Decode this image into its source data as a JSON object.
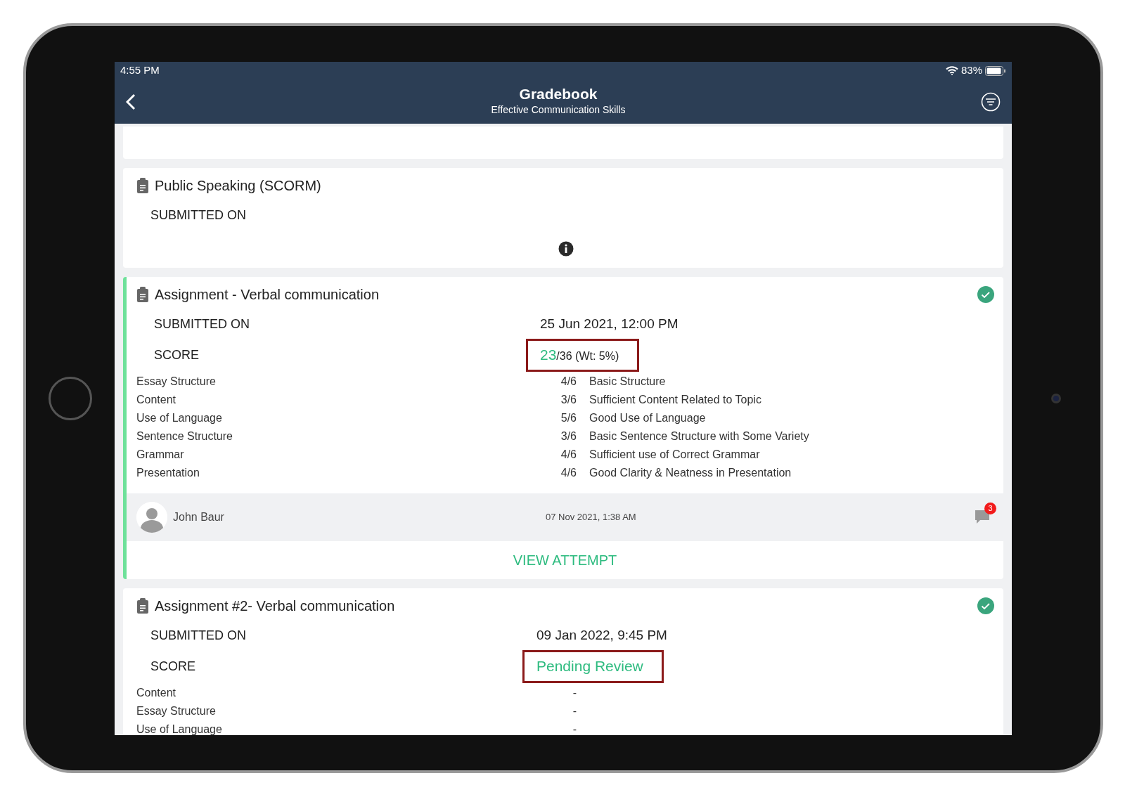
{
  "status_bar": {
    "time": "4:55 PM",
    "battery": "83%"
  },
  "header": {
    "title": "Gradebook",
    "subtitle": "Effective Communication Skills"
  },
  "cards": [
    {
      "kind": "empty"
    },
    {
      "kind": "activity",
      "title": "Public Speaking (SCORM)",
      "completed": false,
      "accent": false,
      "submitted_label": "SUBMITTED ON",
      "info_icon": true
    },
    {
      "kind": "activity",
      "title": "Assignment - Verbal communication",
      "completed": true,
      "accent": true,
      "submitted_label": "SUBMITTED ON",
      "submitted_on": "25 Jun 2021, 12:00 PM",
      "score_label": "SCORE",
      "score": {
        "value": "23",
        "total": "/36 (Wt: 5%)",
        "highlighted": true
      },
      "criteria": [
        {
          "name": "Essay Structure",
          "points": "4/6",
          "comment": "Basic Structure"
        },
        {
          "name": "Content",
          "points": "3/6",
          "comment": "Sufficient Content Related to Topic"
        },
        {
          "name": "Use of Language",
          "points": "5/6",
          "comment": "Good Use of Language"
        },
        {
          "name": "Sentence Structure",
          "points": "3/6",
          "comment": "Basic Sentence Structure with Some Variety"
        },
        {
          "name": "Grammar",
          "points": "4/6",
          "comment": "Sufficient use of Correct Grammar"
        },
        {
          "name": "Presentation",
          "points": "4/6",
          "comment": "Good Clarity & Neatness in Presentation"
        }
      ],
      "grader": {
        "name": "John Baur",
        "date": "07 Nov 2021, 1:38 AM",
        "comment_count": "3"
      },
      "action": "VIEW ATTEMPT"
    },
    {
      "kind": "activity",
      "title": "Assignment #2- Verbal communication",
      "completed": true,
      "accent": false,
      "submitted_label": "SUBMITTED ON",
      "submitted_on": "09 Jan 2022, 9:45 PM",
      "score_label": "SCORE",
      "score": {
        "value": "Pending Review",
        "highlighted": true
      },
      "criteria": [
        {
          "name": "Content",
          "points": "-"
        },
        {
          "name": "Essay Structure",
          "points": "-"
        },
        {
          "name": "Use of Language",
          "points": "-"
        }
      ]
    }
  ]
}
